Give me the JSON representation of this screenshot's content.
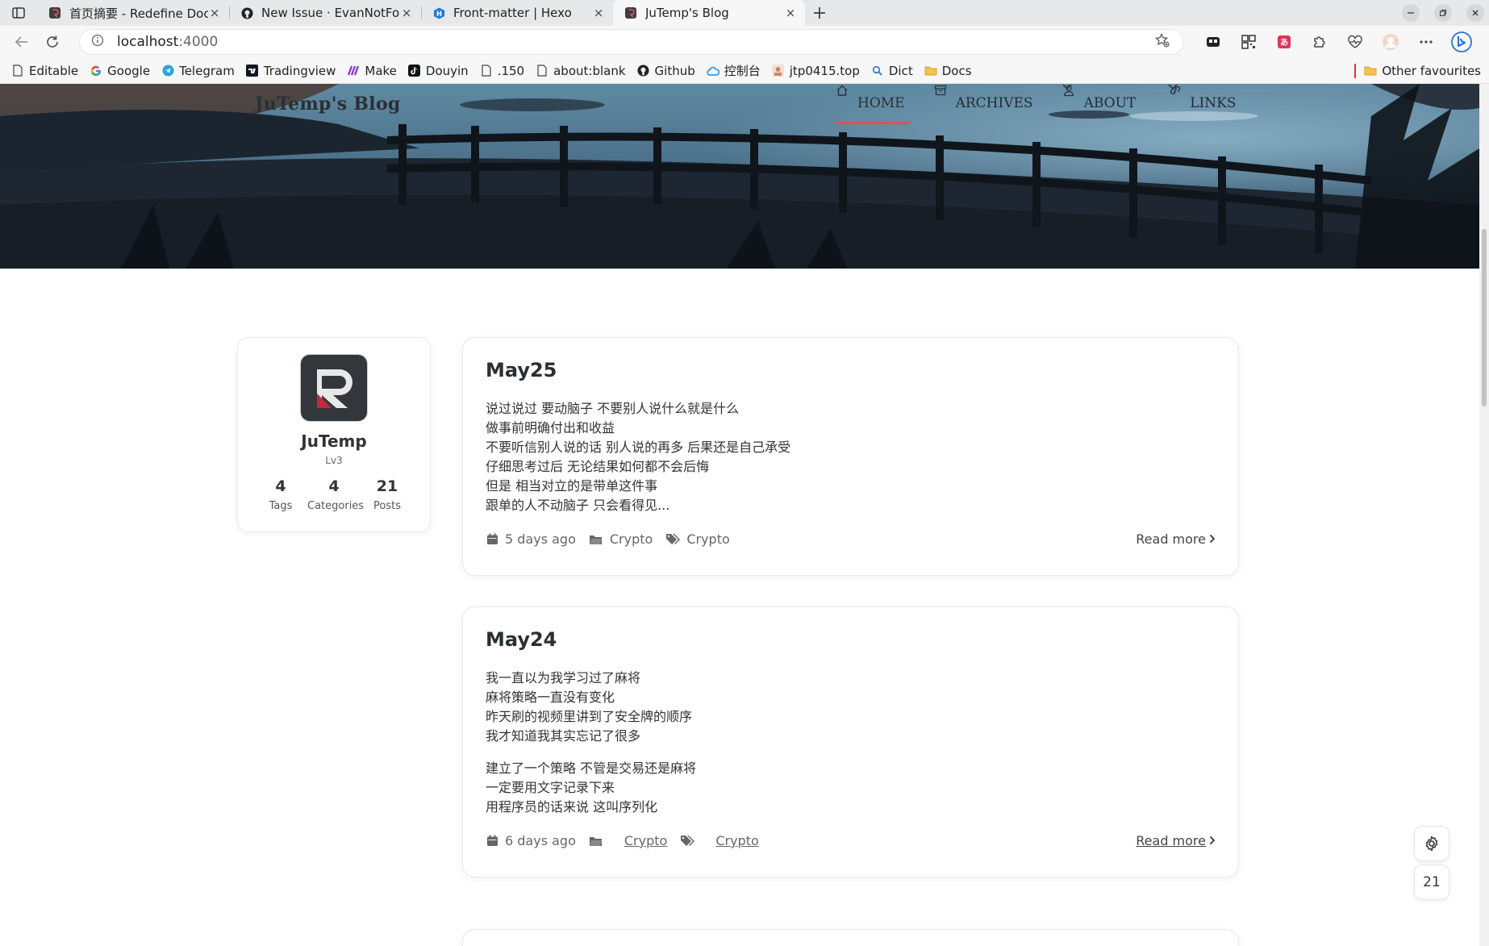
{
  "browser": {
    "tabs": [
      {
        "title": "首页摘要 - Redefine Docs",
        "icon": "redefine-favicon"
      },
      {
        "title": "New Issue · EvanNotFound",
        "icon": "github-favicon"
      },
      {
        "title": "Front-matter | Hexo",
        "icon": "hexo-favicon"
      },
      {
        "title": "JuTemp's Blog",
        "icon": "blog-favicon"
      }
    ],
    "new_tab": "+",
    "close_glyph": "×",
    "address": {
      "host": "localhost",
      "port": ":4000"
    },
    "bookmarks": [
      {
        "label": "Editable",
        "icon": "page-icon"
      },
      {
        "label": "Google",
        "icon": "google-icon"
      },
      {
        "label": "Telegram",
        "icon": "telegram-icon"
      },
      {
        "label": "Tradingview",
        "icon": "tradingview-icon"
      },
      {
        "label": "Make",
        "icon": "make-icon"
      },
      {
        "label": "Douyin",
        "icon": "douyin-icon"
      },
      {
        "label": ".150",
        "icon": "page-icon"
      },
      {
        "label": "about:blank",
        "icon": "page-icon"
      },
      {
        "label": "Github",
        "icon": "github-icon"
      },
      {
        "label": "控制台",
        "icon": "cloud-icon"
      },
      {
        "label": "jtp0415.top",
        "icon": "site-icon"
      },
      {
        "label": "Dict",
        "icon": "search-icon"
      },
      {
        "label": "Docs",
        "icon": "folder-icon"
      }
    ],
    "other_favourites": "Other favourites"
  },
  "site": {
    "title": "JuTemp's Blog",
    "nav": [
      {
        "label": "HOME",
        "icon": "home-icon",
        "active": true,
        "dropdown": false
      },
      {
        "label": "ARCHIVES",
        "icon": "archive-icon",
        "active": false,
        "dropdown": false
      },
      {
        "label": "ABOUT",
        "icon": "user-icon",
        "active": false,
        "dropdown": true
      },
      {
        "label": "LINKS",
        "icon": "link-icon",
        "active": false,
        "dropdown": true
      }
    ]
  },
  "profile": {
    "name": "JuTemp",
    "level": "Lv3",
    "stats": [
      {
        "num": "4",
        "label": "Tags"
      },
      {
        "num": "4",
        "label": "Categories"
      },
      {
        "num": "21",
        "label": "Posts"
      }
    ]
  },
  "posts": [
    {
      "title": "May25",
      "paragraphs": [
        [
          "说过说过 要动脑子 不要别人说什么就是什么",
          "做事前明确付出和收益",
          "不要听信别人说的话 别人说的再多 后果还是自己承受",
          "仔细思考过后 无论结果如何都不会后悔",
          "但是 相当对立的是带单这件事",
          "跟单的人不动脑子 只会看得见..."
        ]
      ],
      "date": "5 days ago",
      "category": "Crypto",
      "tag": "Crypto",
      "read_more": "Read more"
    },
    {
      "title": "May24",
      "paragraphs": [
        [
          "我一直以为我学习过了麻将",
          "麻将策略一直没有变化",
          "昨天刷的视频里讲到了安全牌的顺序",
          "我才知道我其实忘记了很多"
        ],
        [
          "建立了一个策略 不管是交易还是麻将",
          "一定要用文字记录下来",
          "用程序员的话来说 这叫序列化"
        ]
      ],
      "date": "6 days ago",
      "category": "Crypto",
      "tag": "Crypto",
      "read_more": "Read more"
    }
  ],
  "floating": {
    "settings_icon": "gear-icon",
    "post_count": "21"
  },
  "colors": {
    "accent": "#d9534f",
    "card_border": "#e9e9e9"
  }
}
